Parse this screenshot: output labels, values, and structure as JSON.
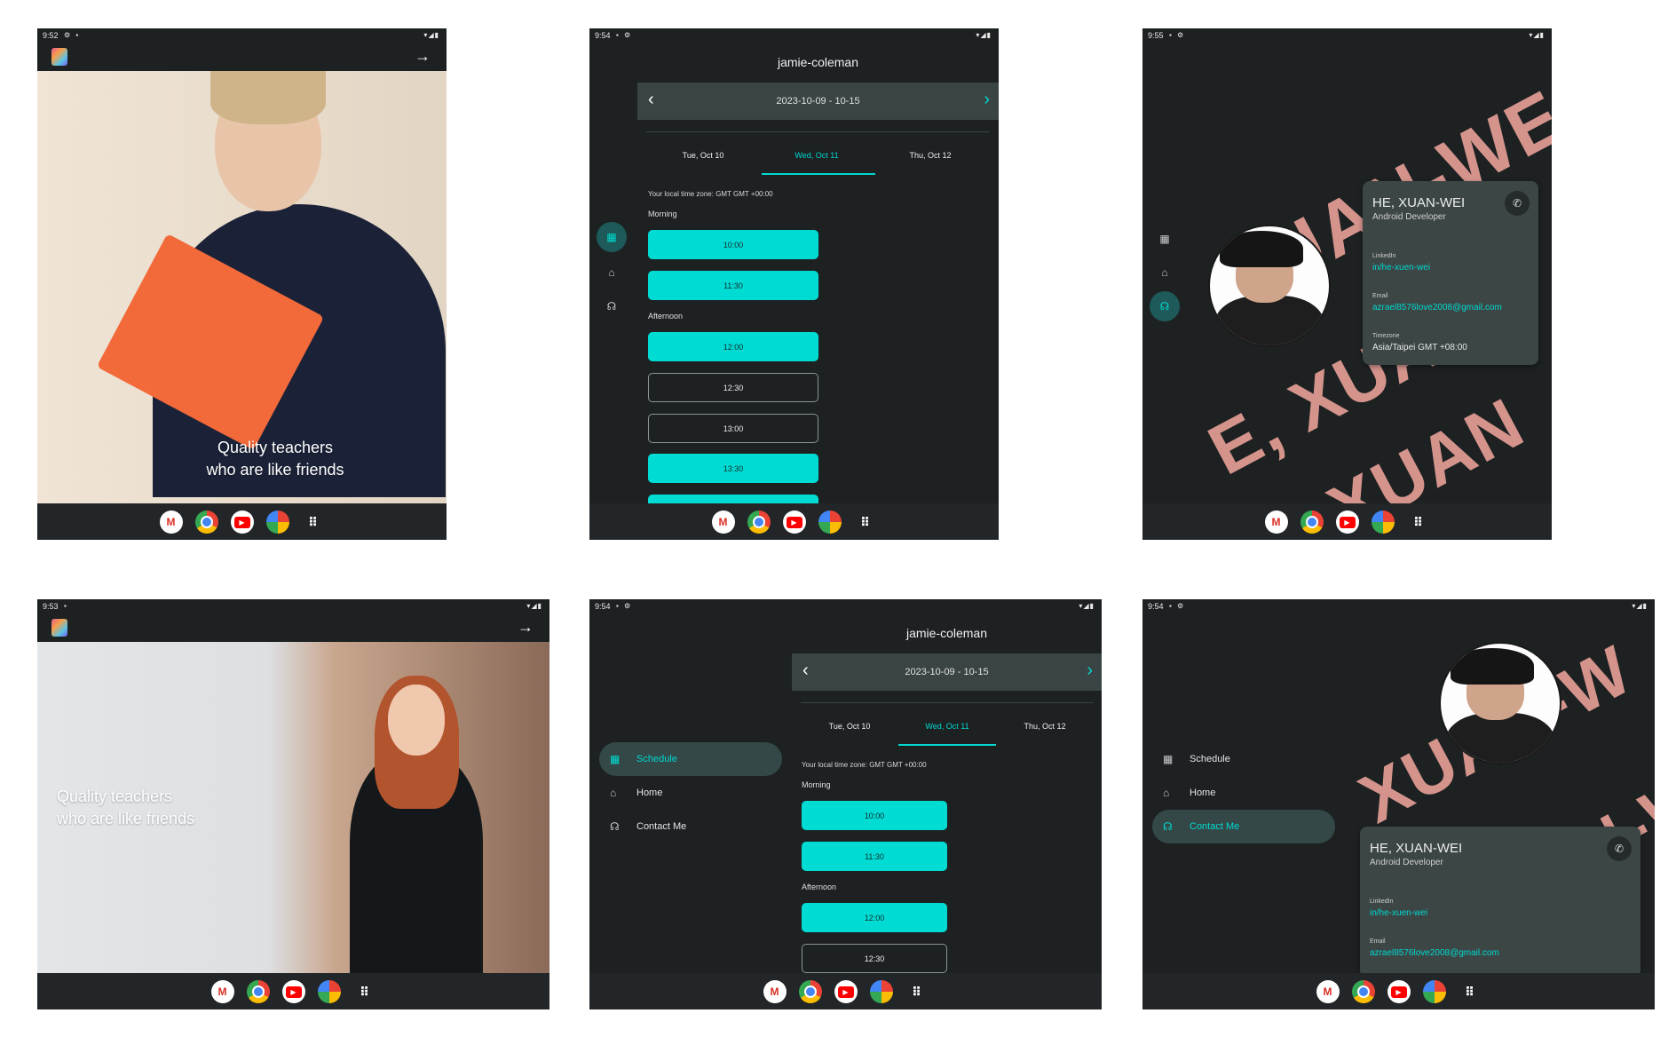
{
  "common": {
    "dock": [
      "gmail-icon",
      "chrome-icon",
      "youtube-icon",
      "photos-icon",
      "app-drawer-icon"
    ],
    "gmail_glyph": "M",
    "youtube_glyph": "▶",
    "apps_glyph": "⠿"
  },
  "onboarding_portrait": {
    "time": "9:52",
    "tagline_line1": "Quality teachers",
    "tagline_line2": "who are like friends"
  },
  "onboarding_landscape": {
    "time": "9:53",
    "tagline_line1": "Quality teachers",
    "tagline_line2": "who are like friends"
  },
  "schedule": {
    "time": "9:54",
    "user": "jamie-coleman",
    "week_range": "2023-10-09 - 10-15",
    "days": [
      "Tue, Oct 10",
      "Wed, Oct 11",
      "Thu, Oct 12"
    ],
    "selected_day": "Wed, Oct 11",
    "timezone_note": "Your local time zone: GMT GMT +00:00",
    "morning_label": "Morning",
    "afternoon_label": "Afternoon",
    "morning_slots": [
      {
        "time": "10:00",
        "available": true
      },
      {
        "time": "11:30",
        "available": true
      }
    ],
    "afternoon_slots": [
      {
        "time": "12:00",
        "available": true
      },
      {
        "time": "12:30",
        "available": false
      },
      {
        "time": "13:00",
        "available": false
      },
      {
        "time": "13:30",
        "available": true
      }
    ]
  },
  "drawer": {
    "items": [
      {
        "label": "Schedule",
        "icon": "calendar-icon"
      },
      {
        "label": "Home",
        "icon": "home-icon"
      },
      {
        "label": "Contact Me",
        "icon": "headset-icon"
      }
    ]
  },
  "contact": {
    "time_portrait": "9:55",
    "time_landscape": "9:54",
    "name": "HE, XUAN-WEI",
    "role": "Android Developer",
    "linkedin_label": "LinkedIn",
    "linkedin": "in/he-xuen-wei",
    "email_label": "Email",
    "email": "azrael8576love2008@gmail.com",
    "timezone_label": "Timezone",
    "timezone": "Asia/Taipei GMT +08:00",
    "bg_word_1": "XUAN-WE",
    "bg_word_2": "E, XUAN",
    "bg_word_3": "HE, XUAN",
    "bg_word_4": "XUAN-W"
  },
  "colors": {
    "accent": "#00d9d0",
    "background": "#1d2122",
    "slot_fill": "#00dcd4",
    "name_art": "#d4948c"
  }
}
